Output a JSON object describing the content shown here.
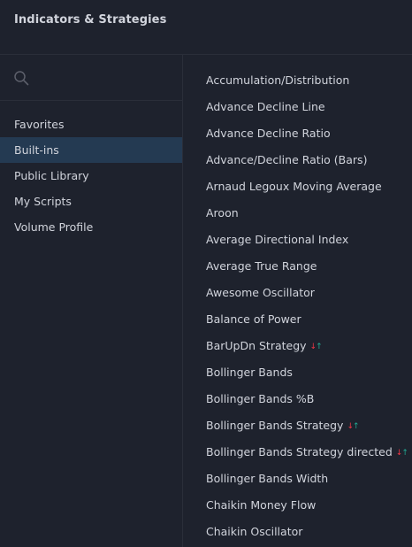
{
  "header": {
    "title": "Indicators & Strategies"
  },
  "search": {
    "placeholder": "",
    "value": "",
    "icon": "search-icon"
  },
  "sidebar": {
    "items": [
      {
        "label": "Favorites",
        "active": false
      },
      {
        "label": "Built-ins",
        "active": true
      },
      {
        "label": "Public Library",
        "active": false
      },
      {
        "label": "My Scripts",
        "active": false
      },
      {
        "label": "Volume Profile",
        "active": false
      }
    ]
  },
  "indicators": [
    {
      "label": "Accumulation/Distribution",
      "strategy": false
    },
    {
      "label": "Advance Decline Line",
      "strategy": false
    },
    {
      "label": "Advance Decline Ratio",
      "strategy": false
    },
    {
      "label": "Advance/Decline Ratio (Bars)",
      "strategy": false
    },
    {
      "label": "Arnaud Legoux Moving Average",
      "strategy": false
    },
    {
      "label": "Aroon",
      "strategy": false
    },
    {
      "label": "Average Directional Index",
      "strategy": false
    },
    {
      "label": "Average True Range",
      "strategy": false
    },
    {
      "label": "Awesome Oscillator",
      "strategy": false
    },
    {
      "label": "Balance of Power",
      "strategy": false
    },
    {
      "label": "BarUpDn Strategy",
      "strategy": true
    },
    {
      "label": "Bollinger Bands",
      "strategy": false
    },
    {
      "label": "Bollinger Bands %B",
      "strategy": false
    },
    {
      "label": "Bollinger Bands Strategy",
      "strategy": true
    },
    {
      "label": "Bollinger Bands Strategy directed",
      "strategy": true
    },
    {
      "label": "Bollinger Bands Width",
      "strategy": false
    },
    {
      "label": "Chaikin Money Flow",
      "strategy": false
    },
    {
      "label": "Chaikin Oscillator",
      "strategy": false
    }
  ],
  "colors": {
    "background": "#1e222d",
    "text": "#d1d4dc",
    "active_background": "#243a52",
    "divider": "#2a2e39",
    "arrow_down": "#f23645",
    "arrow_up": "#22ab94"
  }
}
